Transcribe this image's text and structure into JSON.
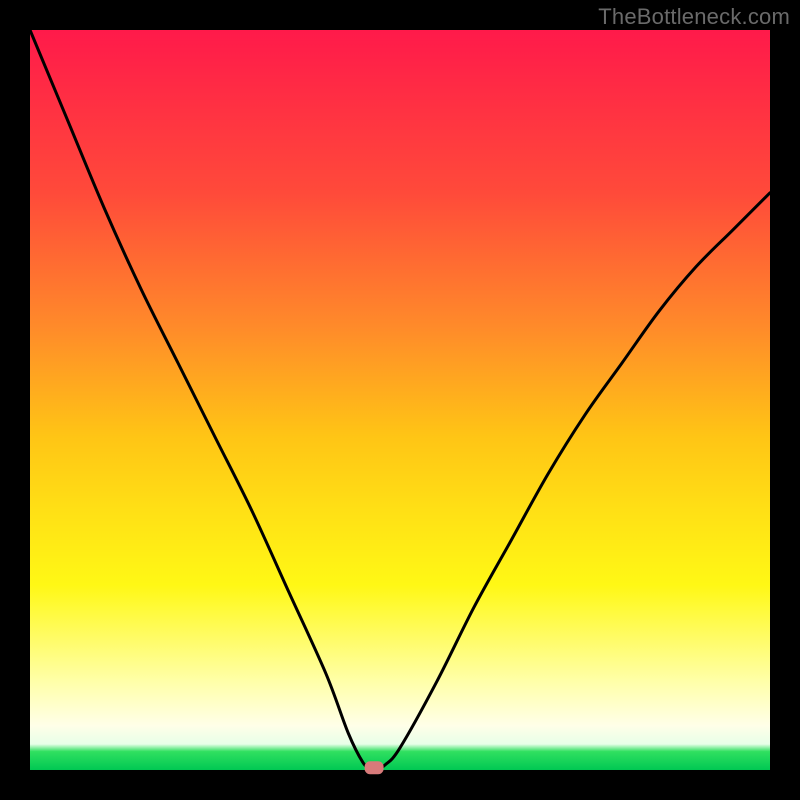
{
  "watermark": "TheBottleneck.com",
  "chart_data": {
    "type": "line",
    "title": "",
    "xlabel": "",
    "ylabel": "",
    "xlim": [
      0,
      100
    ],
    "ylim": [
      0,
      100
    ],
    "grid": false,
    "legend": false,
    "series": [
      {
        "name": "bottleneck-curve",
        "x": [
          0,
          5,
          10,
          15,
          20,
          25,
          30,
          35,
          40,
          43,
          45,
          46,
          47,
          48,
          50,
          55,
          60,
          65,
          70,
          75,
          80,
          85,
          90,
          95,
          100
        ],
        "values": [
          100,
          88,
          76,
          65,
          55,
          45,
          35,
          24,
          13,
          5,
          1,
          0.3,
          0.2,
          0.7,
          3,
          12,
          22,
          31,
          40,
          48,
          55,
          62,
          68,
          73,
          78
        ]
      }
    ],
    "highlight": {
      "x": 46.5,
      "y": 0.3
    },
    "colors": {
      "gradient_top": "#ff1a4a",
      "gradient_mid": "#fff815",
      "gradient_bottom": "#00c853",
      "curve": "#000000",
      "highlight": "#d87a7a"
    }
  }
}
